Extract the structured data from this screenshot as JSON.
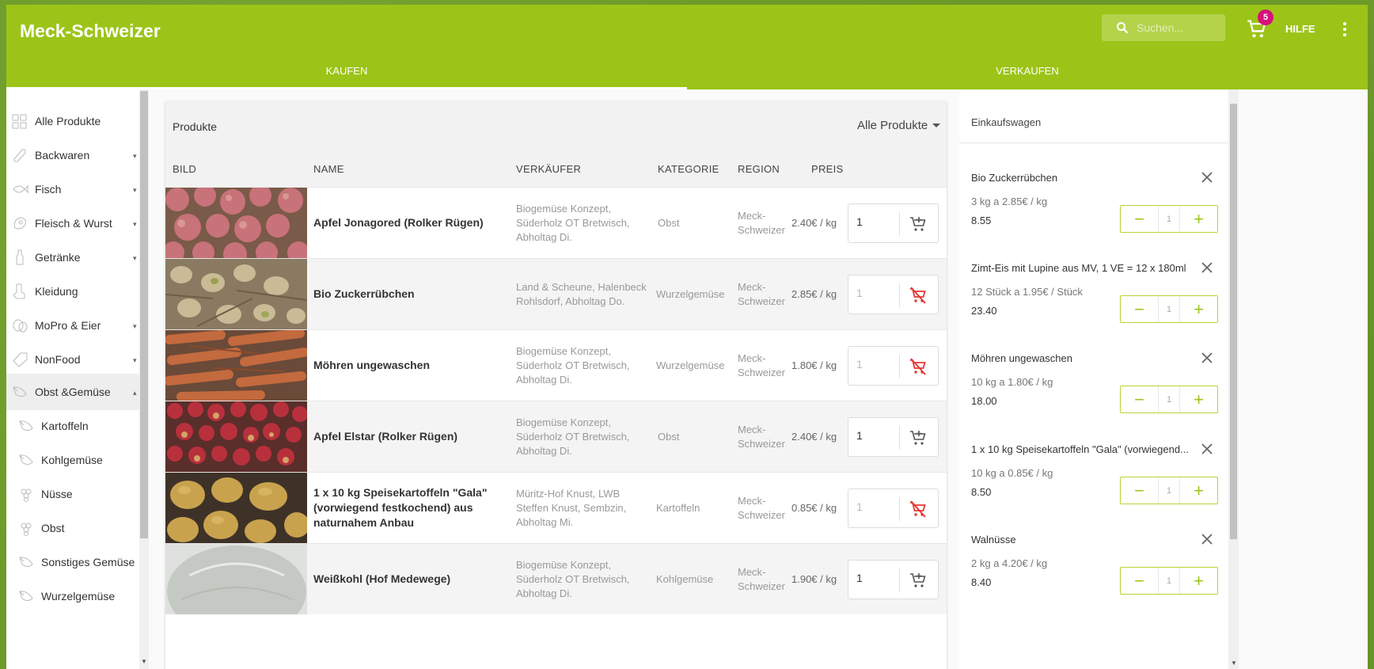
{
  "app": {
    "title": "Meck-Schweizer",
    "search_placeholder": "Suchen...",
    "cart_count": "5",
    "help_label": "HILFE",
    "accent_color": "#9cc418",
    "badge_color": "#d6127a"
  },
  "tabs": [
    {
      "label": "KAUFEN",
      "active": true
    },
    {
      "label": "VERKAUFEN",
      "active": false
    }
  ],
  "sidebar": {
    "items": [
      {
        "label": "Alle Produkte",
        "icon": "grid-icon"
      },
      {
        "label": "Backwaren",
        "icon": "bread-icon"
      },
      {
        "label": "Fisch",
        "icon": "fish-icon"
      },
      {
        "label": "Fleisch & Wurst",
        "icon": "meat-icon"
      },
      {
        "label": "Getränke",
        "icon": "bottle-icon"
      },
      {
        "label": "Kleidung",
        "icon": "clothing-icon"
      },
      {
        "label": "MoPro & Eier",
        "icon": "egg-icon"
      },
      {
        "label": "NonFood",
        "icon": "tag-icon"
      },
      {
        "label": "Obst &Gemüse",
        "icon": "vegetable-icon"
      },
      {
        "label": "Kartoffeln",
        "icon": "vegetable-icon"
      },
      {
        "label": "Kohlgemüse",
        "icon": "vegetable-icon"
      },
      {
        "label": "Nüsse",
        "icon": "grapes-icon"
      },
      {
        "label": "Obst",
        "icon": "grapes-icon"
      },
      {
        "label": "Sonstiges Gemüse",
        "icon": "vegetable-icon"
      },
      {
        "label": "Wurzelgemüse",
        "icon": "vegetable-icon"
      }
    ]
  },
  "products": {
    "title": "Produkte",
    "filter_label": "Alle Produkte",
    "headers": {
      "image": "BILD",
      "name": "NAME",
      "seller": "VERKÄUFER",
      "category": "KATEGORIE",
      "region": "REGION",
      "price": "PREIS"
    },
    "rows": [
      {
        "name": "Apfel Jonagored (Rolker Rügen)",
        "seller": "Biogemüse Konzept, Süderholz OT Bretwisch, Abholtag Di.",
        "category": "Obst",
        "region": "Meck-Schweizer",
        "price": "2.40€ / kg",
        "qty": "1",
        "in_stock": true
      },
      {
        "name": "Bio Zuckerrübchen",
        "seller": "Land & Scheune, Halenbeck Rohlsdorf, Abholtag Do.",
        "category": "Wurzelgemüse",
        "region": "Meck-Schweizer",
        "price": "2.85€ / kg",
        "qty": "1",
        "in_stock": false
      },
      {
        "name": "Möhren ungewaschen",
        "seller": "Biogemüse Konzept, Süderholz OT Bretwisch, Abholtag Di.",
        "category": "Wurzelgemüse",
        "region": "Meck-Schweizer",
        "price": "1.80€ / kg",
        "qty": "1",
        "in_stock": false
      },
      {
        "name": "Apfel Elstar (Rolker Rügen)",
        "seller": "Biogemüse Konzept, Süderholz OT Bretwisch, Abholtag Di.",
        "category": "Obst",
        "region": "Meck-Schweizer",
        "price": "2.40€ / kg",
        "qty": "1",
        "in_stock": true
      },
      {
        "name": "1 x 10 kg Speisekartoffeln \"Gala\" (vorwiegend festkochend) aus naturnahem Anbau",
        "seller": "Müritz-Hof Knust, LWB Steffen Knust, Sembzin, Abholtag Mi.",
        "category": "Kartoffeln",
        "region": "Meck-Schweizer",
        "price": "0.85€ / kg",
        "qty": "1",
        "in_stock": false
      },
      {
        "name": "Weißkohl (Hof Medewege)",
        "seller": "Biogemüse Konzept, Süderholz OT Bretwisch, Abholtag Di.",
        "category": "Kohlgemüse",
        "region": "Meck-Schweizer",
        "price": "1.90€ / kg",
        "qty": "1",
        "in_stock": true
      }
    ]
  },
  "cart": {
    "title": "Einkaufswagen",
    "items": [
      {
        "name": "Bio Zuckerrübchen",
        "detail": "3 kg a 2.85€ / kg",
        "total": "8.55",
        "qty": "1"
      },
      {
        "name": "Zimt-Eis mit Lupine aus MV, 1 VE = 12 x 180ml",
        "detail": "12 Stück a 1.95€ / Stück",
        "total": "23.40",
        "qty": "1"
      },
      {
        "name": "Möhren ungewaschen",
        "detail": "10 kg a 1.80€ / kg",
        "total": "18.00",
        "qty": "1"
      },
      {
        "name": "1 x 10 kg Speisekartoffeln \"Gala\" (vorwiegend...",
        "detail": "10 kg a 0.85€ / kg",
        "total": "8.50",
        "qty": "1"
      },
      {
        "name": "Walnüsse",
        "detail": "2 kg a 4.20€ / kg",
        "total": "8.40",
        "qty": "1"
      }
    ]
  }
}
